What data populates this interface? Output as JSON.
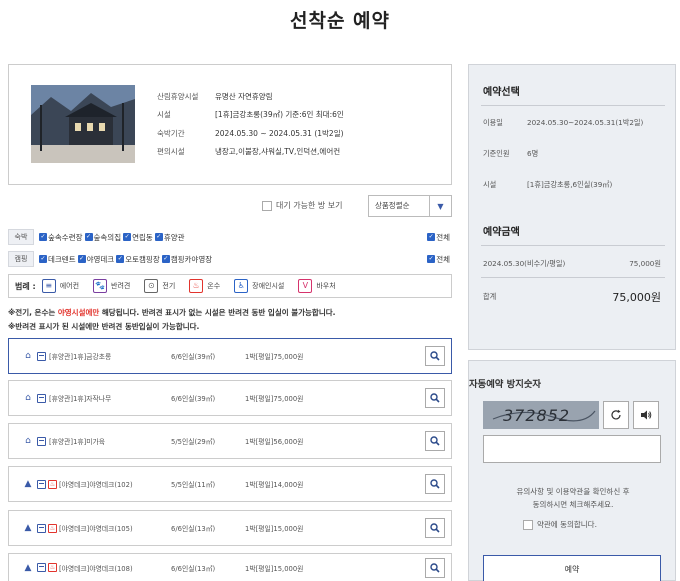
{
  "page": {
    "title": "선착순 예약"
  },
  "facility": {
    "rows": [
      {
        "key": "산림휴양시설",
        "value": "유명산 자연휴양림"
      },
      {
        "key": "시설",
        "value": "[1휴]금강초롱(39㎡) 기준:6인 최대:6인"
      },
      {
        "key": "숙박기간",
        "value": "2024.05.30 ~ 2024.05.31 (1박2일)"
      },
      {
        "key": "편의시설",
        "value": "냉장고,이불장,샤워실,TV,인덕션,에어컨"
      }
    ]
  },
  "filters": {
    "wait_label": "대기 가능한 방 보기",
    "sort_label": "상품정렬순",
    "stay": {
      "tag": "숙박",
      "items": [
        "숲속수련장",
        "숲속의집",
        "연립동",
        "휴양관"
      ],
      "all": "전체"
    },
    "camp": {
      "tag": "캠핑",
      "items": [
        "데크텐트",
        "야영데크",
        "오토캠핑장",
        "캠핑카야영장"
      ],
      "all": "전체"
    }
  },
  "legend": {
    "title": "범례 :",
    "items": [
      "에어컨",
      "반려견",
      "전기",
      "온수",
      "장애인시설",
      "바우처"
    ]
  },
  "notices": {
    "line1_prefix": "※전기, 온수는 ",
    "line1_red": "야영시설에만",
    "line1_suffix": " 해당됩니다. 반려견 표시가 없는 시설은 반려견 동반 입실이 불가능합니다.",
    "line2": "※반려견 표시가 된 시설에만 반려견 동반입실이 가능합니다."
  },
  "rooms": [
    {
      "name": "[휴양관]1휴]금강초롱",
      "capacity": "6/6인실(39㎡)",
      "price": "1박[평일]75,000원"
    },
    {
      "name": "[휴양관]1휴]자작나무",
      "capacity": "6/6인실(39㎡)",
      "price": "1박[평일]75,000원"
    },
    {
      "name": "[휴양관]1휴]미가육",
      "capacity": "5/5인실(29㎡)",
      "price": "1박[평일]56,000원"
    },
    {
      "name": "[야영데크]야영데크(102)",
      "capacity": "5/5인실(11㎡)",
      "price": "1박[평일]14,000원"
    },
    {
      "name": "[야영데크]야영데크(105)",
      "capacity": "6/6인실(13㎡)",
      "price": "1박[평일]15,000원"
    },
    {
      "name": "[야영데크]야영데크(108)",
      "capacity": "6/6인실(13㎡)",
      "price": "1박[평일]15,000원"
    }
  ],
  "selection": {
    "title": "예약선택",
    "rows": [
      {
        "key": "이용일",
        "value": "2024.05.30~2024.05.31(1박2일)"
      },
      {
        "key": "기준인원",
        "value": "6명"
      },
      {
        "key": "시설",
        "value": "[1휴]금강초롱,6인실(39㎡)"
      }
    ],
    "amount_title": "예약금액",
    "amount_date": "2024.05.30(비수기/평일)",
    "amount_value": "75,000원",
    "total_label": "합계",
    "total_value": "75,000원"
  },
  "captcha": {
    "title": "자동예약 방지숫자",
    "code": "372852",
    "notice1": "유의사항 및 이용약관을 확인하신 후",
    "notice2": "동의하시면 체크해주세요.",
    "agree": "약관에 동의합니다.",
    "reserve": "예약"
  }
}
